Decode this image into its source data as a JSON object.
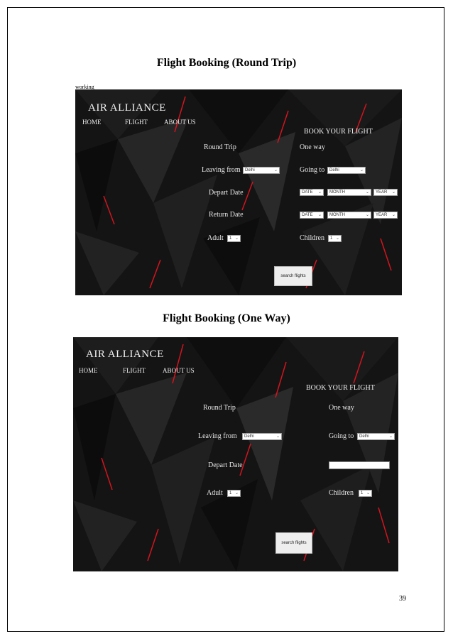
{
  "page": {
    "heading_round_trip": "Flight Booking (Round Trip)",
    "heading_one_way": "Flight Booking (One Way)",
    "caption": "working",
    "page_number": "39"
  },
  "round_trip_screen": {
    "brand": "AIR ALLIANCE",
    "nav": {
      "home": "HOME",
      "flight": "FLIGHT",
      "about": "ABOUT US"
    },
    "book_title": "BOOK YOUR FLIGHT",
    "round_trip": "Round Trip",
    "one_way": "One way",
    "leaving_from": "Leaving from",
    "leaving_value": "Delhi",
    "going_to": "Going to",
    "going_value": "Delhi",
    "depart_date": "Depart Date",
    "return_date": "Return Date",
    "date": "DATE",
    "month": "MONTH",
    "year": "YEAR",
    "adult": "Adult",
    "adult_value": "1",
    "children": "Children",
    "children_value": "1",
    "search": "search flights"
  },
  "one_way_screen": {
    "brand": "AIR ALLIANCE",
    "nav": {
      "home": "HOME",
      "flight": "FLIGHT",
      "about": "ABOUT US"
    },
    "book_title": "BOOK YOUR FLIGHT",
    "round_trip": "Round Trip",
    "one_way": "One way",
    "leaving_from": "Leaving from",
    "leaving_value": "Delhi",
    "going_to": "Going to",
    "going_value": "Delhi",
    "depart_date": "Depart Date",
    "depart_input_value": "",
    "adult": "Adult",
    "adult_value": "1",
    "children": "Children",
    "children_value": "1",
    "search": "search flights"
  },
  "colors": {
    "background": "#121212",
    "accent": "#d4141e"
  }
}
